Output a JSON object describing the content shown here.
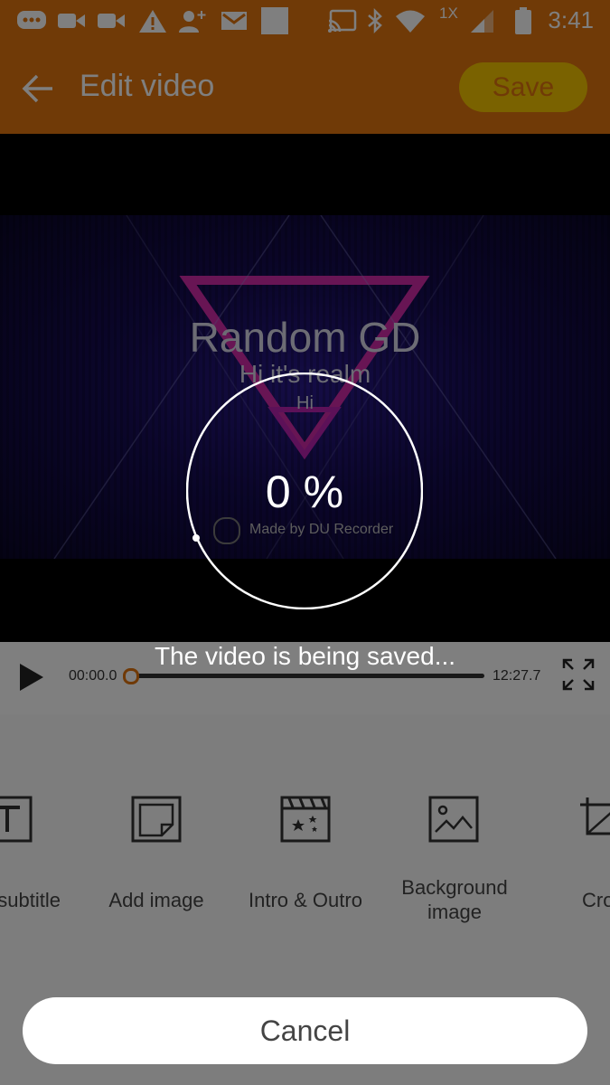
{
  "status_bar": {
    "time": "3:41",
    "network_label": "1X",
    "icons": [
      "chat-icon",
      "video-call-icon",
      "video-call-icon",
      "warning-icon",
      "add-person-icon",
      "gmail-icon",
      "blank-notification-icon",
      "cast-icon",
      "bluetooth-icon",
      "wifi-icon",
      "signal-icon",
      "battery-icon"
    ]
  },
  "app_bar": {
    "title": "Edit video",
    "save_label": "Save",
    "accent": "#e0740f",
    "save_color": "#f5c400"
  },
  "preview": {
    "main_text": "Random GD",
    "sub_text": "Hi it's realm",
    "small_text": "Hi",
    "watermark": "Made by DU Recorder"
  },
  "player": {
    "start_time": "00:00.0",
    "end_time": "12:27.7",
    "progress": 0
  },
  "tools": [
    {
      "label": "subtitle",
      "icon": "text-icon"
    },
    {
      "label": "Add image",
      "icon": "sticker-icon"
    },
    {
      "label": "Intro & Outro",
      "icon": "clapperboard-icon"
    },
    {
      "label": "Background image",
      "icon": "image-icon"
    },
    {
      "label": "Cro",
      "icon": "crop-icon"
    }
  ],
  "saving_dialog": {
    "message": "The video is being saved...",
    "percent_text": "0 %",
    "percent_value": 0,
    "cancel_label": "Cancel"
  }
}
